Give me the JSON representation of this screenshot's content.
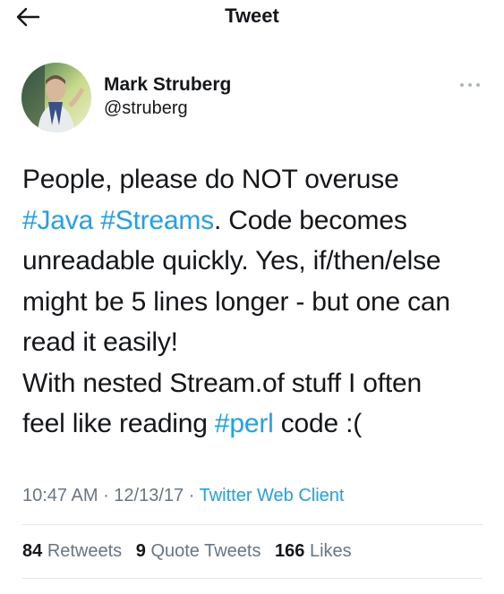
{
  "nav": {
    "title": "Tweet",
    "back_icon": "arrow-left-icon"
  },
  "author": {
    "display_name": "Mark Struberg",
    "handle": "@struberg",
    "avatar_icon": "avatar-photo"
  },
  "more_icon": "ellipsis-horizontal-icon",
  "tweet": {
    "line1": "People, please do NOT overuse",
    "line2_hashtag1": "#Java",
    "line2_space": " ",
    "line2_hashtag2": "#Streams",
    "line2_rest": ". Code becomes",
    "line3": "unreadable quickly. Yes, if/then/else",
    "line4": "might be 5 lines longer - but one can",
    "line5": "read it easily!",
    "line6": "With nested Stream.of stuff I often",
    "line7_prefix": "feel like reading ",
    "line7_hashtag": "#perl",
    "line7_suffix": " code :("
  },
  "meta": {
    "time": "10:47 AM",
    "sep1": " · ",
    "date": "12/13/17",
    "sep2": " · ",
    "source": "Twitter Web Client"
  },
  "stats": {
    "retweets_count": "84",
    "retweets_label": "Retweets",
    "quotes_count": "9",
    "quotes_label": "Quote Tweets",
    "likes_count": "166",
    "likes_label": "Likes"
  },
  "colors": {
    "link": "#1da1f2",
    "secondary_text": "#657786",
    "primary_text": "#14171a",
    "divider": "#e1e8ed"
  }
}
